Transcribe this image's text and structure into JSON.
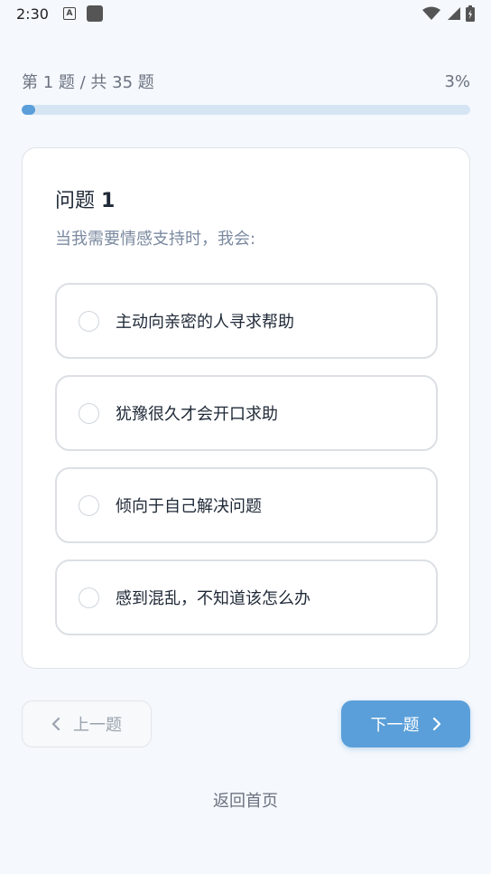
{
  "status_bar": {
    "time": "2:30",
    "app_icon_letter": "A"
  },
  "progress": {
    "label": "第 1 题 / 共 35 题",
    "percent_text": "3%",
    "fraction": 0.03
  },
  "question": {
    "title_prefix": "问题 ",
    "number": "1",
    "text": "当我需要情感支持时，我会:",
    "options": [
      "主动向亲密的人寻求帮助",
      "犹豫很久才会开口求助",
      "倾向于自己解决问题",
      "感到混乱，不知道该怎么办"
    ]
  },
  "nav": {
    "prev_label": "上一题",
    "next_label": "下一题",
    "home_label": "返回首页"
  },
  "colors": {
    "accent": "#5a9fd9",
    "track": "#d6e5f4",
    "background": "#f5f8fc"
  }
}
